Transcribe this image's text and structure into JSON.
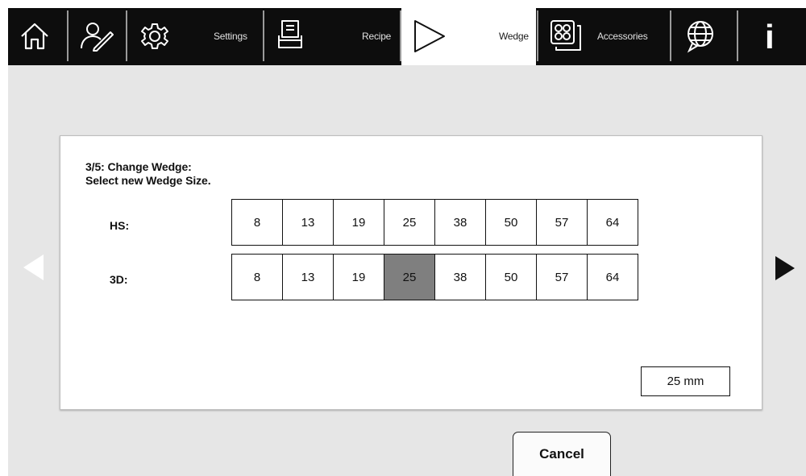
{
  "toolbar": {
    "tabs": [
      {
        "id": "home",
        "icon": "home-icon",
        "label": ""
      },
      {
        "id": "user",
        "icon": "user-edit-icon",
        "label": ""
      },
      {
        "id": "settings",
        "icon": "gear-icon",
        "label": "Settings"
      },
      {
        "id": "recipe",
        "icon": "recipe-icon",
        "label": "Recipe"
      },
      {
        "id": "wedge",
        "icon": "wedge-icon",
        "label": "Wedge",
        "active": true
      },
      {
        "id": "accessories",
        "icon": "accessories-icon",
        "label": "Accessories"
      },
      {
        "id": "language",
        "icon": "globe-icon",
        "label": ""
      },
      {
        "id": "info",
        "icon": "info-icon",
        "label": ""
      }
    ],
    "info_glyph": "i"
  },
  "dialog": {
    "step": "3/5: Change Wedge:",
    "instruction": "Select new Wedge Size.",
    "rows": [
      {
        "label": "HS:",
        "sizes": [
          "8",
          "13",
          "19",
          "25",
          "38",
          "50",
          "57",
          "64"
        ],
        "selected": null
      },
      {
        "label": "3D:",
        "sizes": [
          "8",
          "13",
          "19",
          "25",
          "38",
          "50",
          "57",
          "64"
        ],
        "selected": "25"
      }
    ],
    "readout": "25 mm"
  },
  "nav": {
    "prev_icon": "arrow-left-icon",
    "next_icon": "arrow-right-icon"
  },
  "actions": {
    "cancel_label": "Cancel"
  },
  "colors": {
    "toolbar_bg": "#0d0d0d",
    "background": "#e6e6e6",
    "selected_cell": "#7f7f7f",
    "active_tab": "#ffffff"
  }
}
